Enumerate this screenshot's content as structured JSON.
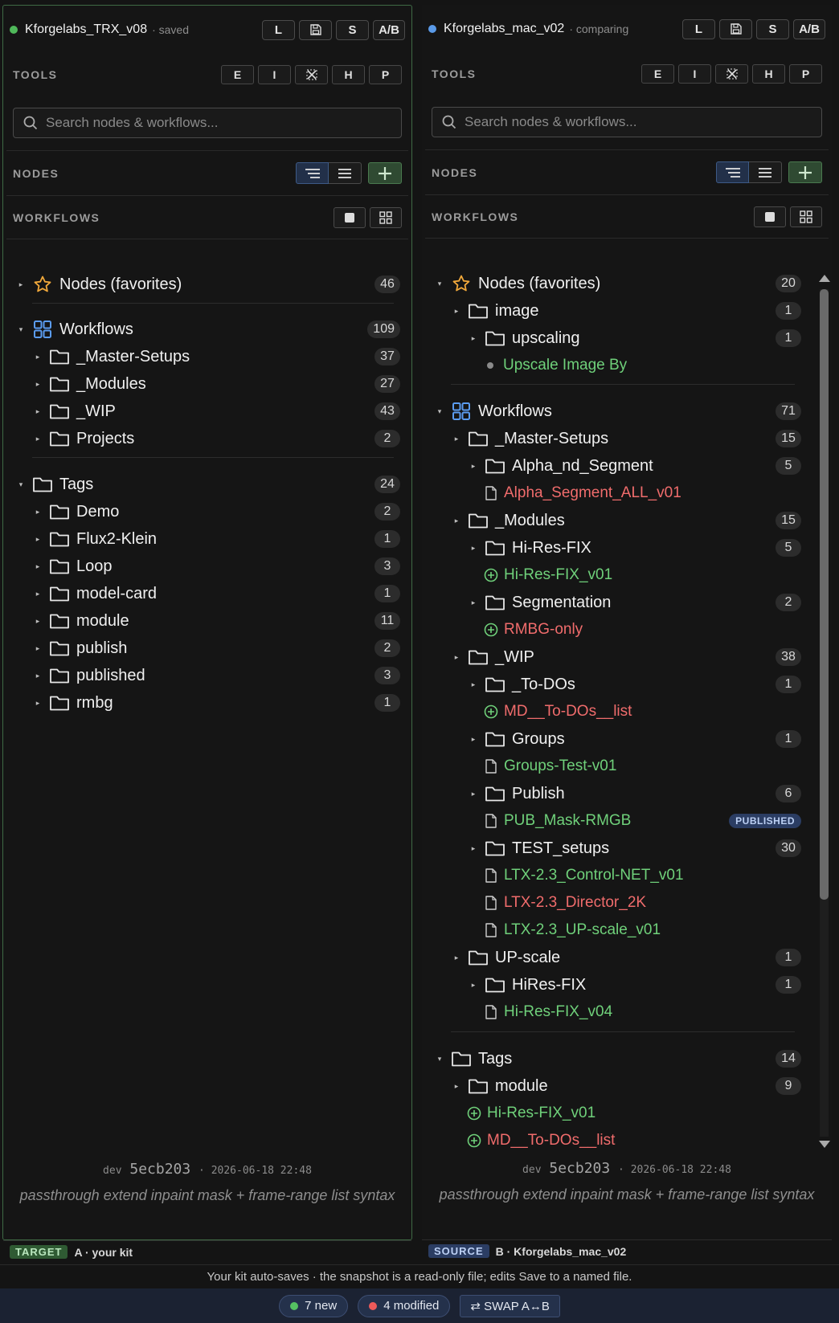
{
  "panel_a": {
    "kit_name": "Kforgelabs_TRX_v08",
    "status": "· saved",
    "status_color": "#4fb85a",
    "header_buttons": [
      "L",
      "S",
      "A/B"
    ],
    "tools_label": "TOOLS",
    "tools_buttons": [
      "E",
      "I",
      "H",
      "P"
    ],
    "search_placeholder": "Search nodes & workflows...",
    "nodes_label": "NODES",
    "workflows_label": "WORKFLOWS",
    "tree": [
      {
        "label": "Nodes (favorites)",
        "count": "46"
      },
      {
        "label": "Workflows",
        "count": "109"
      },
      {
        "label": "_Master-Setups",
        "count": "37"
      },
      {
        "label": "_Modules",
        "count": "27"
      },
      {
        "label": "_WIP",
        "count": "43"
      },
      {
        "label": "Projects",
        "count": "2"
      },
      {
        "label": "Tags",
        "count": "24"
      },
      {
        "label": "Demo",
        "count": "2"
      },
      {
        "label": "Flux2-Klein",
        "count": "1"
      },
      {
        "label": "Loop",
        "count": "3"
      },
      {
        "label": "model-card",
        "count": "1"
      },
      {
        "label": "module",
        "count": "11"
      },
      {
        "label": "publish",
        "count": "2"
      },
      {
        "label": "published",
        "count": "3"
      },
      {
        "label": "rmbg",
        "count": "1"
      }
    ],
    "footer": {
      "env": "dev",
      "hash": "5ecb203",
      "sep": "·",
      "date": "2026-06-18 22:48",
      "description": "passthrough extend inpaint mask + frame-range list syntax"
    },
    "role_tag": "TARGET",
    "role_text": "A · your kit"
  },
  "panel_b": {
    "kit_name": "Kforgelabs_mac_v02",
    "status": "· comparing",
    "status_color": "#5a9ae8",
    "header_buttons": [
      "L",
      "S",
      "A/B"
    ],
    "tools_label": "TOOLS",
    "tools_buttons": [
      "E",
      "I",
      "H",
      "P"
    ],
    "search_placeholder": "Search nodes & workflows...",
    "nodes_label": "NODES",
    "workflows_label": "WORKFLOWS",
    "tree": [
      {
        "label": "Nodes (favorites)",
        "count": "20"
      },
      {
        "label": "image",
        "count": "1"
      },
      {
        "label": "upscaling",
        "count": "1"
      },
      {
        "label": "Upscale Image By"
      },
      {
        "label": "Workflows",
        "count": "71"
      },
      {
        "label": "_Master-Setups",
        "count": "15"
      },
      {
        "label": "Alpha_nd_Segment",
        "count": "5"
      },
      {
        "label": "Alpha_Segment_ALL_v01"
      },
      {
        "label": "_Modules",
        "count": "15"
      },
      {
        "label": "Hi-Res-FIX",
        "count": "5"
      },
      {
        "label": "Hi-Res-FIX_v01"
      },
      {
        "label": "Segmentation",
        "count": "2"
      },
      {
        "label": "RMBG-only"
      },
      {
        "label": "_WIP",
        "count": "38"
      },
      {
        "label": "_To-DOs",
        "count": "1"
      },
      {
        "label": "MD__To-DOs__list"
      },
      {
        "label": "Groups",
        "count": "1"
      },
      {
        "label": "Groups-Test-v01"
      },
      {
        "label": "Publish",
        "count": "6"
      },
      {
        "label": "PUB_Mask-RMGB",
        "badge": "PUBLISHED"
      },
      {
        "label": "TEST_setups",
        "count": "30"
      },
      {
        "label": "LTX-2.3_Control-NET_v01"
      },
      {
        "label": "LTX-2.3_Director_2K"
      },
      {
        "label": "LTX-2.3_UP-scale_v01"
      },
      {
        "label": "UP-scale",
        "count": "1"
      },
      {
        "label": "HiRes-FIX",
        "count": "1"
      },
      {
        "label": "Hi-Res-FIX_v04"
      },
      {
        "label": "Tags",
        "count": "14"
      },
      {
        "label": "module",
        "count": "9"
      },
      {
        "label": "Hi-Res-FIX_v01"
      },
      {
        "label": "MD__To-DOs__list"
      }
    ],
    "footer": {
      "env": "dev",
      "hash": "5ecb203",
      "sep": "·",
      "date": "2026-06-18 22:48",
      "description": "passthrough extend inpaint mask + frame-range list syntax"
    },
    "role_tag": "SOURCE",
    "role_text": "B · Kforgelabs_mac_v02"
  },
  "notice": "Your kit auto-saves · the snapshot is a read-only file; edits Save to a named file.",
  "bottom": {
    "new_label": "7 new",
    "modified_label": "4 modified",
    "swap_label": "⇄ SWAP A↔B"
  }
}
